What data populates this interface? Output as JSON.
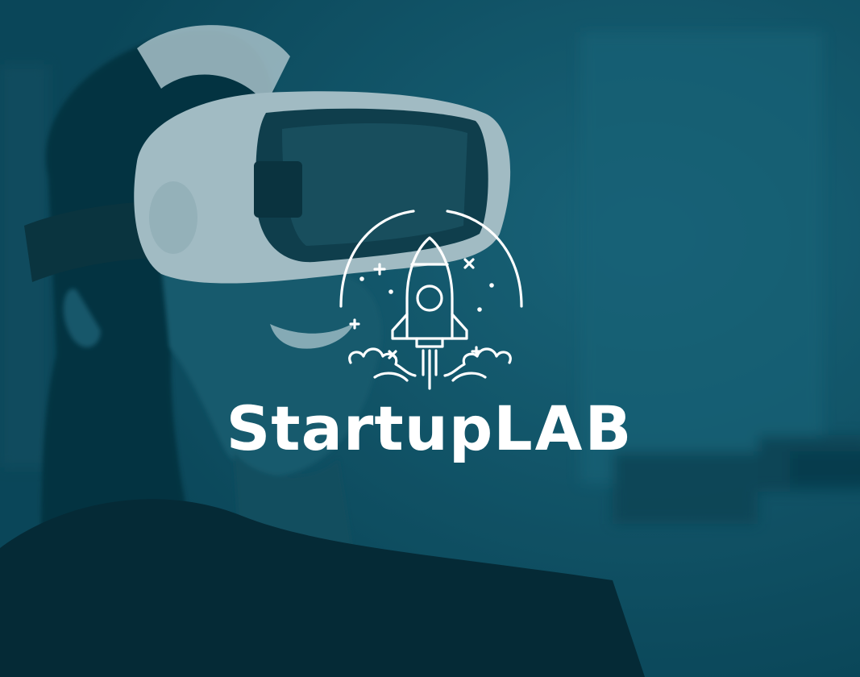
{
  "brand": {
    "name_part_1": "Startup",
    "name_part_2": "LAB"
  },
  "icons": {
    "logo": "rocket-launch-icon"
  },
  "colors": {
    "background_tint": "#0e5366",
    "shadow": "#06303c",
    "highlight": "#2a7a8e",
    "logo": "#ffffff"
  }
}
